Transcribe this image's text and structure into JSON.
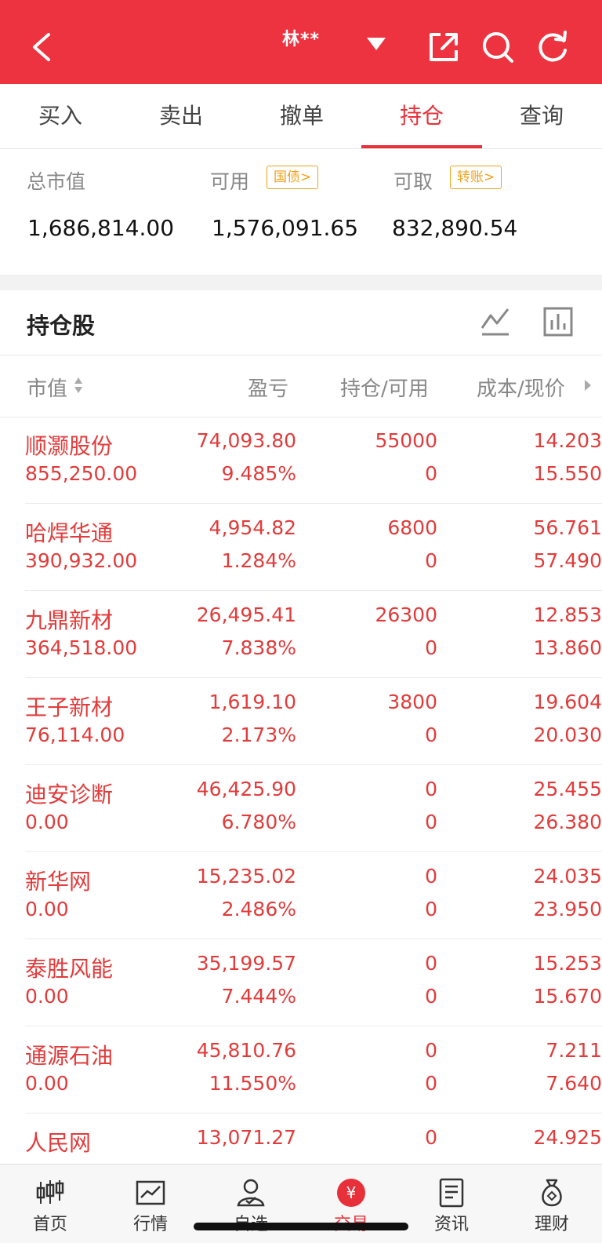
{
  "header": {
    "title": "林**"
  },
  "tabs": [
    "买入",
    "卖出",
    "撤单",
    "持仓",
    "查询"
  ],
  "active_tab": 3,
  "summary": {
    "total_label": "总市值",
    "total_value": "1,686,814.00",
    "available_label": "可用",
    "available_badge": "国债>",
    "available_value": "1,576,091.65",
    "withdraw_label": "可取",
    "withdraw_badge": "转账>",
    "withdraw_value": "832,890.54"
  },
  "holdings": {
    "title": "持仓股",
    "columns": [
      "市值",
      "盈亏",
      "持仓/可用",
      "成本/现价"
    ],
    "rows": [
      {
        "name": "顺灏股份",
        "market_value": "855,250.00",
        "pl": "74,093.80",
        "pl_ratio": "9.485%",
        "hold": "55000",
        "avail": "0",
        "cost": "14.203",
        "price": "15.550"
      },
      {
        "name": "哈焊华通",
        "market_value": "390,932.00",
        "pl": "4,954.82",
        "pl_ratio": "1.284%",
        "hold": "6800",
        "avail": "0",
        "cost": "56.761",
        "price": "57.490"
      },
      {
        "name": "九鼎新材",
        "market_value": "364,518.00",
        "pl": "26,495.41",
        "pl_ratio": "7.838%",
        "hold": "26300",
        "avail": "0",
        "cost": "12.853",
        "price": "13.860"
      },
      {
        "name": "王子新材",
        "market_value": "76,114.00",
        "pl": "1,619.10",
        "pl_ratio": "2.173%",
        "hold": "3800",
        "avail": "0",
        "cost": "19.604",
        "price": "20.030"
      },
      {
        "name": "迪安诊断",
        "market_value": "0.00",
        "pl": "46,425.90",
        "pl_ratio": "6.780%",
        "hold": "0",
        "avail": "0",
        "cost": "25.455",
        "price": "26.380"
      },
      {
        "name": "新华网",
        "market_value": "0.00",
        "pl": "15,235.02",
        "pl_ratio": "2.486%",
        "hold": "0",
        "avail": "0",
        "cost": "24.035",
        "price": "23.950"
      },
      {
        "name": "泰胜风能",
        "market_value": "0.00",
        "pl": "35,199.57",
        "pl_ratio": "7.444%",
        "hold": "0",
        "avail": "0",
        "cost": "15.253",
        "price": "15.670"
      },
      {
        "name": "通源石油",
        "market_value": "0.00",
        "pl": "45,810.76",
        "pl_ratio": "11.550%",
        "hold": "0",
        "avail": "0",
        "cost": "7.211",
        "price": "7.640"
      },
      {
        "name": "人民网",
        "market_value": "",
        "pl": "13,071.27",
        "pl_ratio": "",
        "hold": "0",
        "avail": "",
        "cost": "24.925",
        "price": ""
      }
    ]
  },
  "bottom_nav": [
    "首页",
    "行情",
    "自选",
    "交易",
    "资讯",
    "理财"
  ],
  "bottom_active": 3,
  "colors": {
    "brand_red": "#ee3340",
    "gain_red": "#e23b3b",
    "badge_orange": "#f0a21e"
  }
}
